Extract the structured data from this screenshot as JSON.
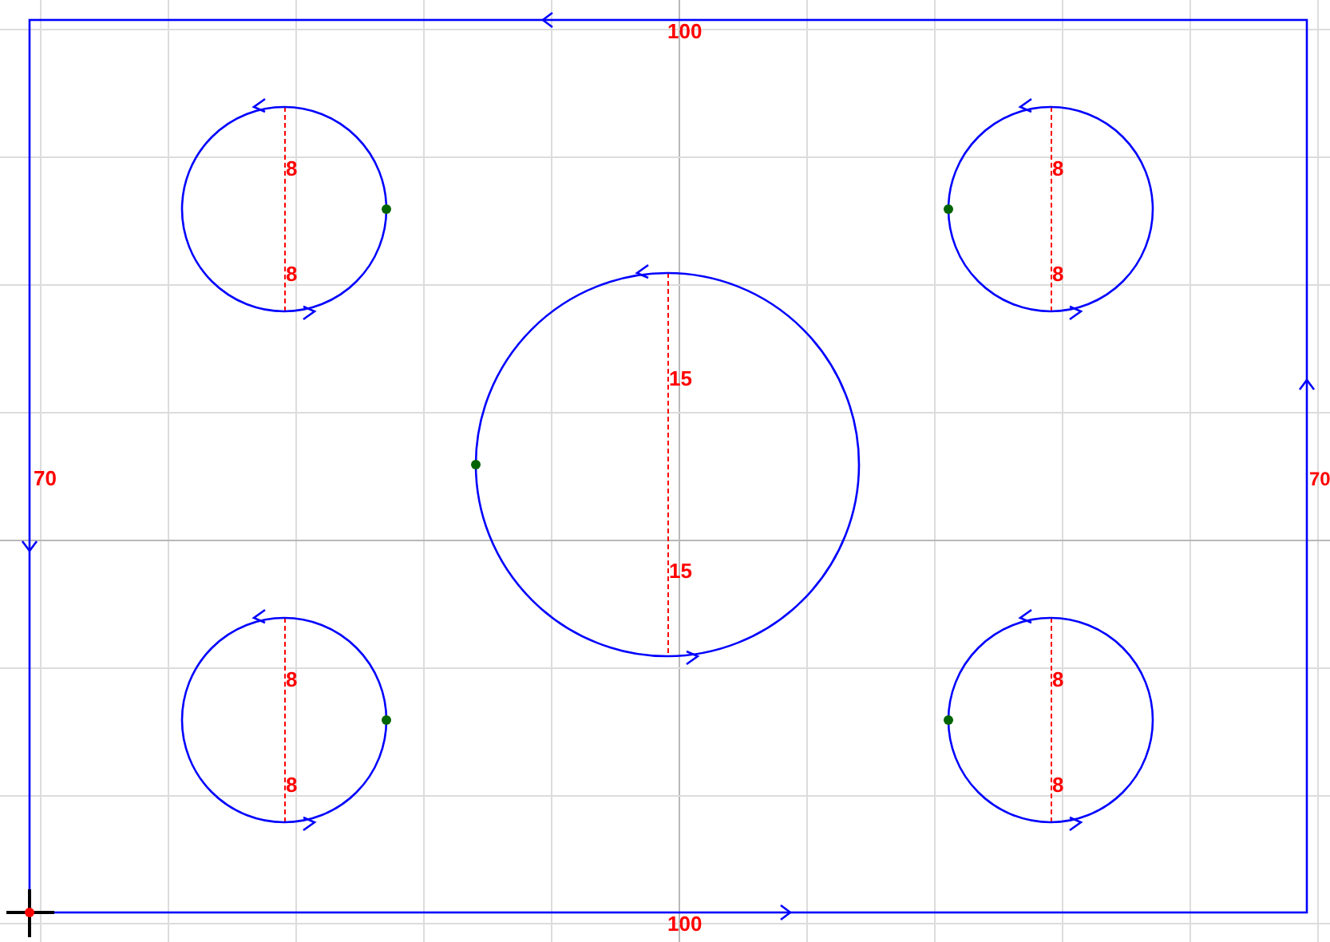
{
  "outline": {
    "top_label": "100",
    "bottom_label": "100",
    "left_label": "70",
    "right_label": "70"
  },
  "circles": [
    {
      "upper_label": "8",
      "lower_label": "8"
    },
    {
      "upper_label": "8",
      "lower_label": "8"
    },
    {
      "upper_label": "15",
      "lower_label": "15"
    },
    {
      "upper_label": "8",
      "lower_label": "8"
    },
    {
      "upper_label": "8",
      "lower_label": "8"
    }
  ]
}
